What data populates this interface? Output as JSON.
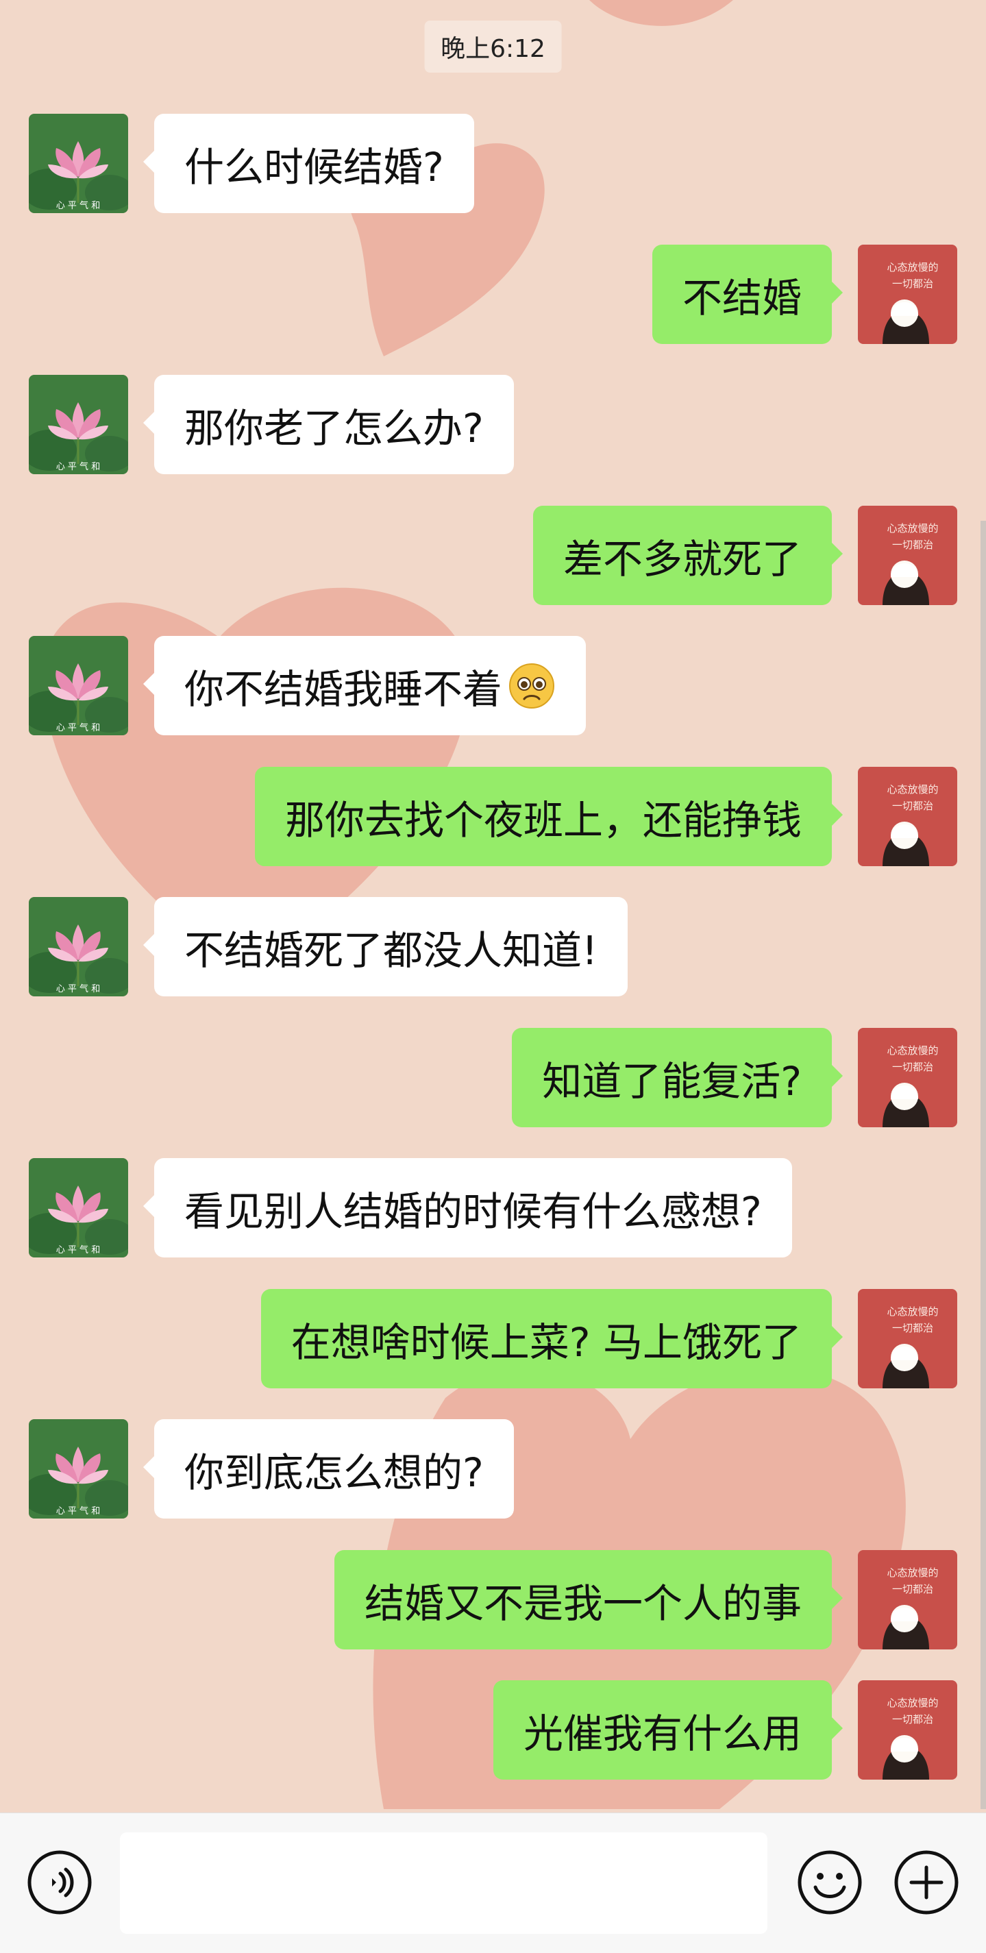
{
  "time_label": "晚上6:12",
  "colors": {
    "incoming": "#ffffff",
    "outgoing": "#95ec69",
    "background": "#f2d8c9"
  },
  "messages": [
    {
      "side": "in",
      "text": "什么时候结婚?"
    },
    {
      "side": "out",
      "text": "不结婚"
    },
    {
      "side": "in",
      "text": "那你老了怎么办?"
    },
    {
      "side": "out",
      "text": "差不多就死了"
    },
    {
      "side": "in",
      "text": "你不结婚我睡不着",
      "emoji": "pleading-face"
    },
    {
      "side": "out",
      "text": "那你去找个夜班上，还能挣钱"
    },
    {
      "side": "in",
      "text": "不结婚死了都没人知道!"
    },
    {
      "side": "out",
      "text": "知道了能复活?"
    },
    {
      "side": "in",
      "text": "看见别人结婚的时候有什么感想?"
    },
    {
      "side": "out",
      "text": "在想啥时候上菜? 马上饿死了"
    },
    {
      "side": "in",
      "text": "你到底怎么想的?"
    },
    {
      "side": "out",
      "text": "结婚又不是我一个人的事"
    },
    {
      "side": "out",
      "text": "光催我有什么用"
    }
  ],
  "avatars": {
    "incoming": {
      "icon": "lotus-avatar",
      "caption": "心 平 气 和"
    },
    "outgoing": {
      "icon": "girl-avatar",
      "caption_lines": [
        "心态放慢的",
        "一切都治"
      ]
    }
  },
  "input_bar": {
    "voice_icon": "voice-icon",
    "emoji_icon": "emoji-icon",
    "plus_icon": "plus-icon",
    "value": ""
  }
}
